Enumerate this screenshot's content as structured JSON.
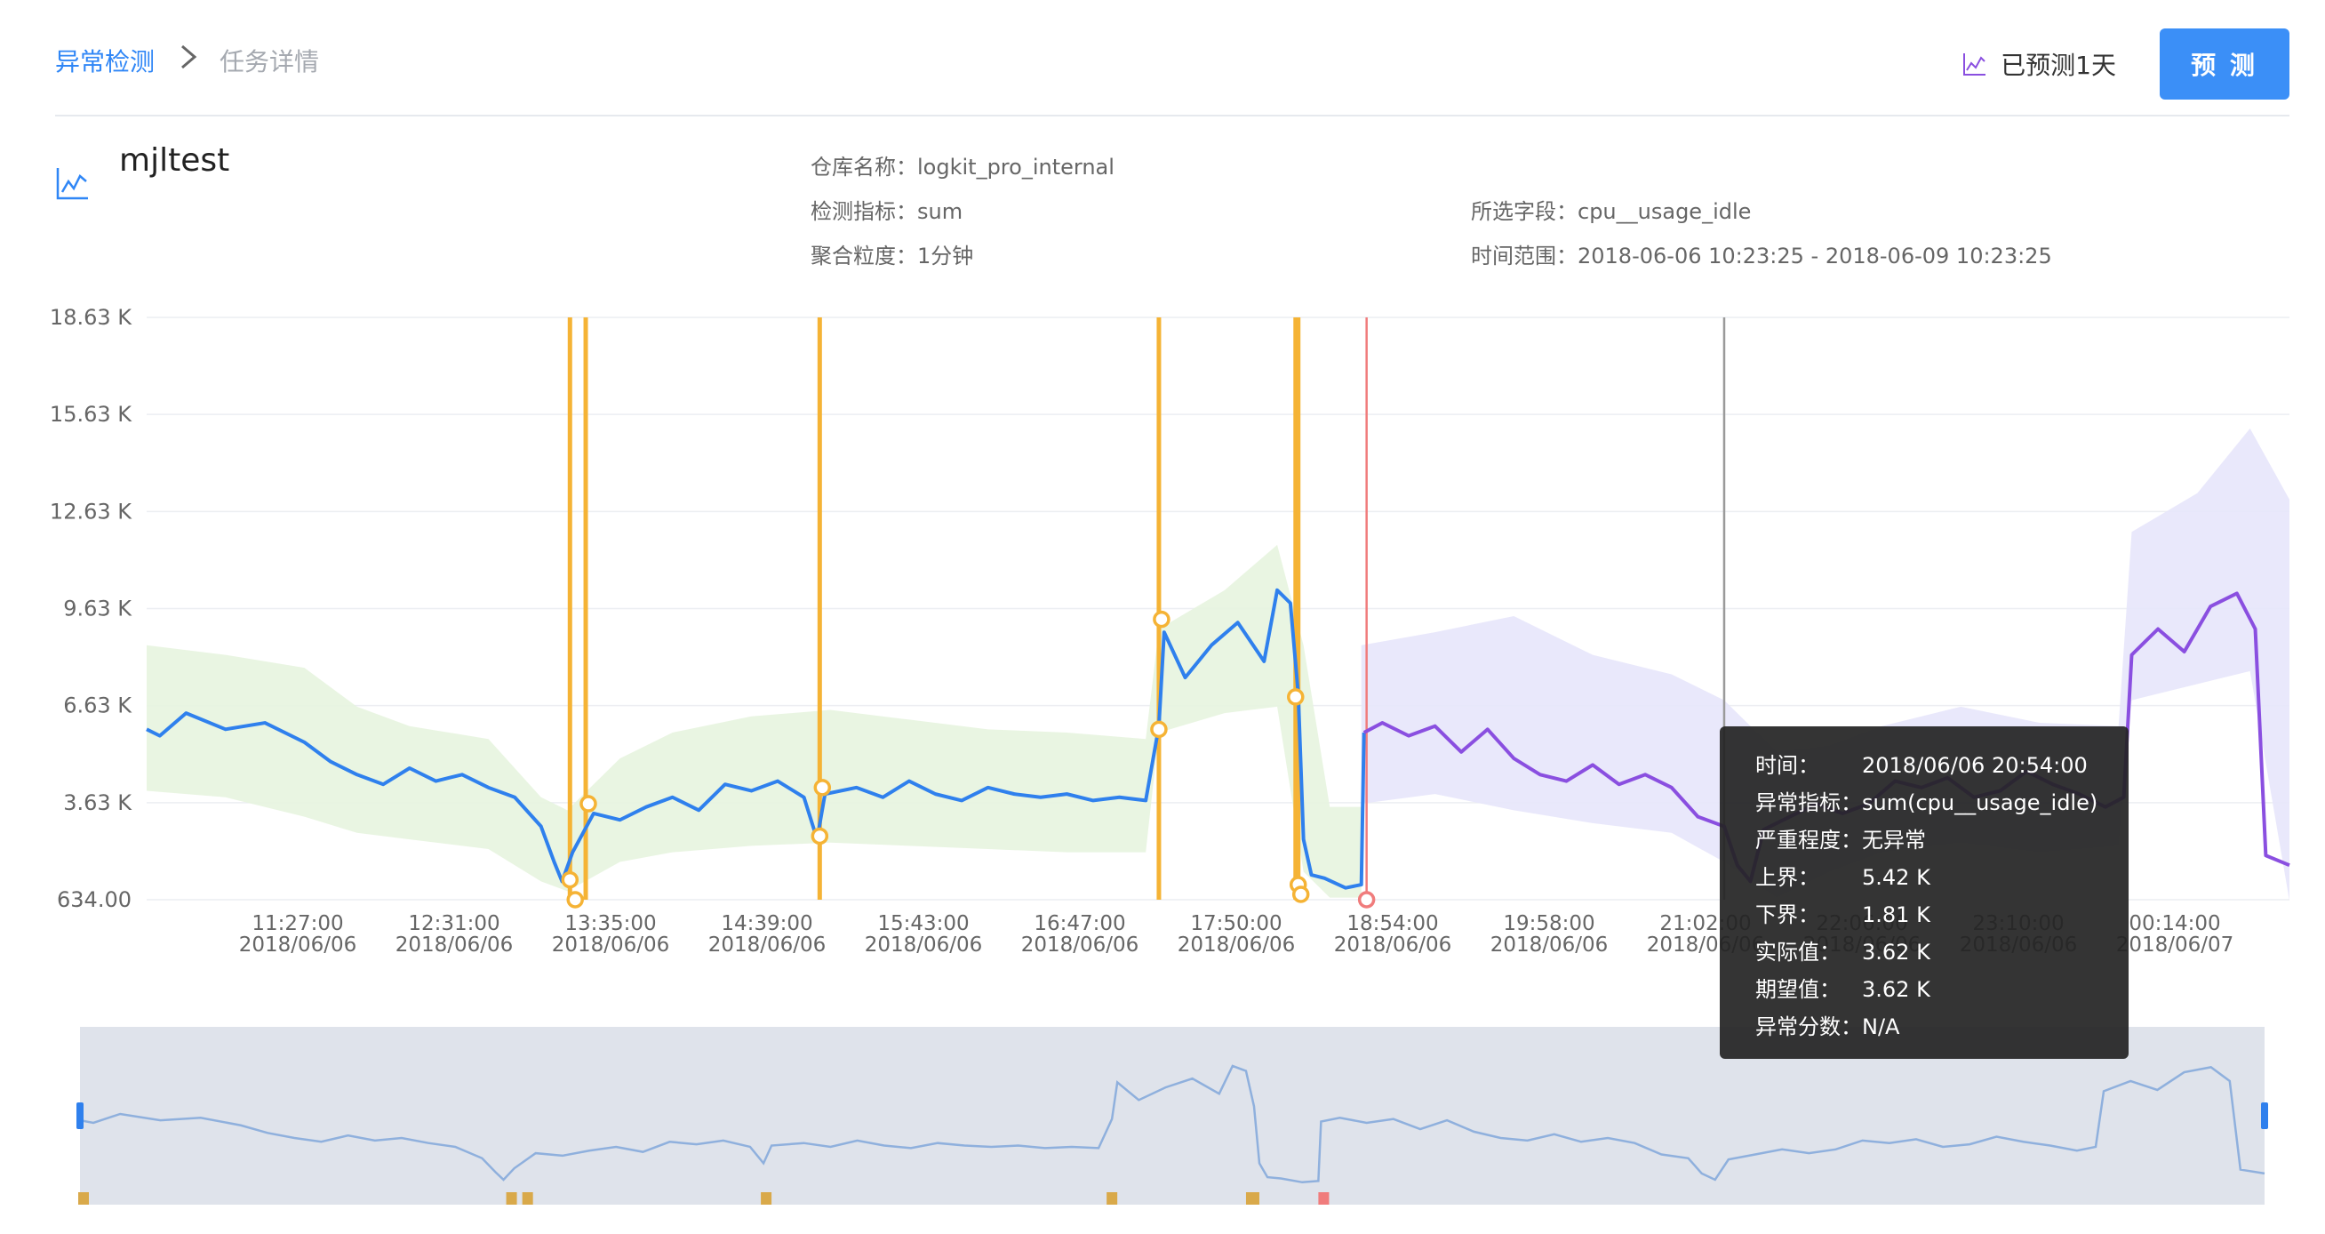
{
  "breadcrumb": {
    "home": "异常检测",
    "current": "任务详情"
  },
  "header": {
    "predict_status": "已预测1天",
    "predict_button": "预 测"
  },
  "task": {
    "name": "mjltest",
    "meta": [
      {
        "key": "仓库名称：",
        "value": "logkit_pro_internal"
      },
      {
        "key": "检测指标：",
        "value": "sum"
      },
      {
        "key": "聚合粒度：",
        "value": "1分钟"
      },
      {
        "key": "所选字段：",
        "value": "cpu__usage_idle"
      },
      {
        "key": "时间范围：",
        "value": "2018-06-06 10:23:25 - 2018-06-09 10:23:25"
      }
    ]
  },
  "colors": {
    "actual": "#2f80ed",
    "forecast": "#8a4fe0",
    "band_hist": "#e7f4df",
    "band_pred": "#e7e6fb",
    "anomaly": "#f5b335",
    "anomaly_high": "#f07c7c",
    "navigator_bg": "#dfe3eb",
    "navigator_line": "#8fb0dd"
  },
  "chart_data": {
    "type": "line",
    "y_ticks": [
      "18.63 K",
      "15.63 K",
      "12.63 K",
      "9.63 K",
      "6.63 K",
      "3.63 K",
      "634.00"
    ],
    "ylim": [
      634,
      18630
    ],
    "x_ticks": [
      {
        "time": "11:27:00",
        "date": "2018/06/06"
      },
      {
        "time": "12:31:00",
        "date": "2018/06/06"
      },
      {
        "time": "13:35:00",
        "date": "2018/06/06"
      },
      {
        "time": "14:39:00",
        "date": "2018/06/06"
      },
      {
        "time": "15:43:00",
        "date": "2018/06/06"
      },
      {
        "time": "16:47:00",
        "date": "2018/06/06"
      },
      {
        "time": "17:50:00",
        "date": "2018/06/06"
      },
      {
        "time": "18:54:00",
        "date": "2018/06/06"
      },
      {
        "time": "19:58:00",
        "date": "2018/06/06"
      },
      {
        "time": "21:02:00",
        "date": "2018/06/06"
      },
      {
        "time": "22:06:00",
        "date": "2018/06/06"
      },
      {
        "time": "23:10:00",
        "date": "2018/06/06"
      },
      {
        "time": "00:14:00",
        "date": "2018/06/07"
      }
    ],
    "actual_series": [
      [
        0,
        5900
      ],
      [
        5,
        5700
      ],
      [
        15,
        6400
      ],
      [
        30,
        5900
      ],
      [
        45,
        6100
      ],
      [
        60,
        5500
      ],
      [
        70,
        4900
      ],
      [
        80,
        4500
      ],
      [
        90,
        4200
      ],
      [
        100,
        4700
      ],
      [
        110,
        4300
      ],
      [
        120,
        4500
      ],
      [
        130,
        4100
      ],
      [
        140,
        3800
      ],
      [
        150,
        2900
      ],
      [
        155,
        1800
      ],
      [
        158,
        1200
      ],
      [
        162,
        2100
      ],
      [
        170,
        3300
      ],
      [
        180,
        3100
      ],
      [
        190,
        3500
      ],
      [
        200,
        3800
      ],
      [
        210,
        3400
      ],
      [
        220,
        4200
      ],
      [
        230,
        4000
      ],
      [
        240,
        4300
      ],
      [
        250,
        3800
      ],
      [
        255,
        2500
      ],
      [
        258,
        3900
      ],
      [
        270,
        4100
      ],
      [
        280,
        3800
      ],
      [
        290,
        4300
      ],
      [
        300,
        3900
      ],
      [
        310,
        3700
      ],
      [
        320,
        4100
      ],
      [
        330,
        3900
      ],
      [
        340,
        3800
      ],
      [
        350,
        3900
      ],
      [
        360,
        3700
      ],
      [
        370,
        3800
      ],
      [
        380,
        3700
      ],
      [
        385,
        6000
      ],
      [
        387,
        8900
      ],
      [
        395,
        7500
      ],
      [
        405,
        8500
      ],
      [
        415,
        9200
      ],
      [
        425,
        8000
      ],
      [
        430,
        10200
      ],
      [
        435,
        9800
      ],
      [
        438,
        7000
      ],
      [
        440,
        2500
      ],
      [
        443,
        1400
      ],
      [
        448,
        1300
      ],
      [
        456,
        1000
      ],
      [
        462,
        1100
      ],
      [
        463,
        5800
      ]
    ],
    "forecast_series": [
      [
        463,
        5800
      ],
      [
        470,
        6100
      ],
      [
        480,
        5700
      ],
      [
        490,
        6000
      ],
      [
        500,
        5200
      ],
      [
        510,
        5900
      ],
      [
        520,
        5000
      ],
      [
        530,
        4500
      ],
      [
        540,
        4300
      ],
      [
        550,
        4800
      ],
      [
        560,
        4200
      ],
      [
        570,
        4500
      ],
      [
        580,
        4100
      ],
      [
        590,
        3200
      ],
      [
        600,
        2900
      ],
      [
        605,
        1700
      ],
      [
        610,
        1200
      ],
      [
        615,
        2800
      ],
      [
        625,
        3200
      ],
      [
        635,
        3600
      ],
      [
        645,
        3300
      ],
      [
        655,
        3600
      ],
      [
        665,
        4300
      ],
      [
        675,
        4100
      ],
      [
        685,
        4400
      ],
      [
        695,
        3800
      ],
      [
        705,
        4000
      ],
      [
        715,
        4600
      ],
      [
        725,
        4200
      ],
      [
        735,
        3900
      ],
      [
        745,
        3500
      ],
      [
        752,
        3800
      ],
      [
        755,
        8200
      ],
      [
        765,
        9000
      ],
      [
        775,
        8300
      ],
      [
        785,
        9700
      ],
      [
        795,
        10100
      ],
      [
        802,
        9000
      ],
      [
        806,
        2000
      ],
      [
        815,
        1700
      ]
    ],
    "band_hist_upper": [
      [
        0,
        8500
      ],
      [
        30,
        8200
      ],
      [
        60,
        7800
      ],
      [
        80,
        6600
      ],
      [
        100,
        6000
      ],
      [
        130,
        5600
      ],
      [
        150,
        3800
      ],
      [
        160,
        3400
      ],
      [
        180,
        5000
      ],
      [
        200,
        5800
      ],
      [
        230,
        6300
      ],
      [
        260,
        6500
      ],
      [
        290,
        6200
      ],
      [
        320,
        5900
      ],
      [
        350,
        5800
      ],
      [
        380,
        5600
      ],
      [
        385,
        9000
      ],
      [
        410,
        10200
      ],
      [
        430,
        11600
      ],
      [
        440,
        8500
      ],
      [
        450,
        3500
      ],
      [
        462,
        3500
      ]
    ],
    "band_hist_lower": [
      [
        0,
        4000
      ],
      [
        30,
        3800
      ],
      [
        60,
        3200
      ],
      [
        80,
        2700
      ],
      [
        100,
        2500
      ],
      [
        130,
        2200
      ],
      [
        150,
        1200
      ],
      [
        160,
        900
      ],
      [
        180,
        1800
      ],
      [
        200,
        2100
      ],
      [
        230,
        2300
      ],
      [
        260,
        2400
      ],
      [
        290,
        2300
      ],
      [
        320,
        2200
      ],
      [
        350,
        2100
      ],
      [
        380,
        2100
      ],
      [
        385,
        5800
      ],
      [
        410,
        6400
      ],
      [
        430,
        6600
      ],
      [
        440,
        1500
      ],
      [
        450,
        700
      ],
      [
        462,
        700
      ]
    ],
    "band_pred_upper": [
      [
        462,
        8500
      ],
      [
        490,
        8900
      ],
      [
        520,
        9400
      ],
      [
        550,
        8200
      ],
      [
        580,
        7600
      ],
      [
        600,
        6800
      ],
      [
        620,
        5200
      ],
      [
        640,
        5400
      ],
      [
        660,
        6000
      ],
      [
        690,
        6600
      ],
      [
        720,
        6100
      ],
      [
        750,
        6000
      ],
      [
        755,
        12000
      ],
      [
        780,
        13200
      ],
      [
        800,
        15200
      ],
      [
        815,
        13000
      ]
    ],
    "band_pred_lower": [
      [
        462,
        3600
      ],
      [
        490,
        3900
      ],
      [
        520,
        3400
      ],
      [
        550,
        3000
      ],
      [
        580,
        2700
      ],
      [
        600,
        1800
      ],
      [
        620,
        700
      ],
      [
        640,
        1500
      ],
      [
        660,
        2100
      ],
      [
        690,
        2400
      ],
      [
        720,
        2100
      ],
      [
        750,
        2300
      ],
      [
        755,
        6800
      ],
      [
        780,
        7300
      ],
      [
        800,
        7700
      ],
      [
        815,
        600
      ]
    ],
    "anomalies": [
      {
        "x": 161,
        "y": 1250,
        "level": "warn"
      },
      {
        "x": 163,
        "y": 634,
        "level": "warn"
      },
      {
        "x": 168,
        "y": 3600,
        "level": "warn"
      },
      {
        "x": 256,
        "y": 2600,
        "level": "warn"
      },
      {
        "x": 257,
        "y": 4100,
        "level": "warn"
      },
      {
        "x": 385,
        "y": 5900,
        "level": "warn"
      },
      {
        "x": 386,
        "y": 9300,
        "level": "warn"
      },
      {
        "x": 437,
        "y": 6900,
        "level": "warn"
      },
      {
        "x": 438,
        "y": 1100,
        "level": "warn"
      },
      {
        "x": 439,
        "y": 800,
        "level": "warn"
      },
      {
        "x": 464,
        "y": 634,
        "level": "high"
      }
    ],
    "anomaly_lines": [
      {
        "x": 161,
        "level": "warn"
      },
      {
        "x": 167,
        "level": "warn"
      },
      {
        "x": 256,
        "level": "warn"
      },
      {
        "x": 385,
        "level": "warn"
      },
      {
        "x": 437,
        "level": "warn"
      },
      {
        "x": 438,
        "level": "warn"
      },
      {
        "x": 464,
        "level": "high"
      },
      {
        "x": 600,
        "level": "cursor"
      }
    ],
    "x_range": [
      0,
      815
    ]
  },
  "tooltip": [
    {
      "key": "时间：",
      "value": "2018/06/06 20:54:00"
    },
    {
      "key": "异常指标：",
      "value": "sum(cpu__usage_idle)"
    },
    {
      "key": "严重程度：",
      "value": "无异常"
    },
    {
      "key": "上界：",
      "value": "5.42 K"
    },
    {
      "key": "下界：",
      "value": "1.81 K"
    },
    {
      "key": "实际值：",
      "value": "3.62 K"
    },
    {
      "key": "期望值：",
      "value": "3.62 K"
    },
    {
      "key": "异常分数：",
      "value": "N/A"
    }
  ]
}
